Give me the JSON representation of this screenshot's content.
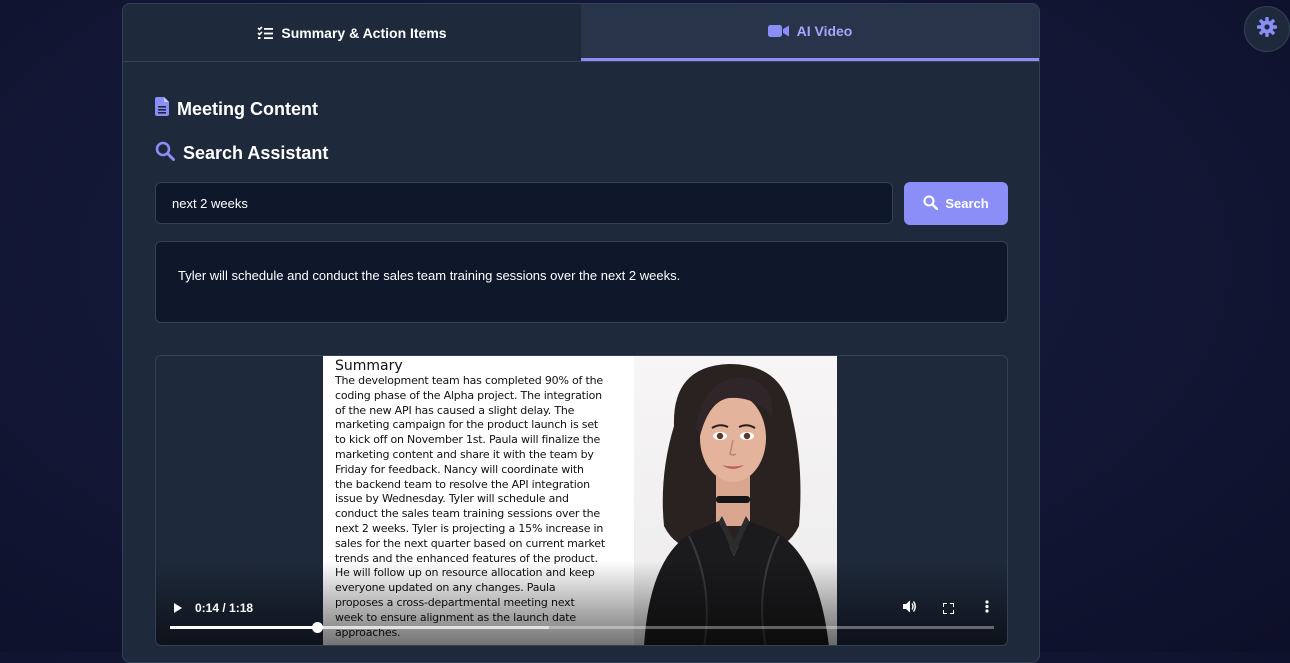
{
  "tabs": {
    "summary_label": "Summary & Action Items",
    "video_label": "AI Video"
  },
  "content": {
    "meeting_heading": "Meeting Content",
    "search_heading": "Search Assistant"
  },
  "search": {
    "value": "next 2 weeks",
    "button_label": "Search",
    "result": "Tyler will schedule and conduct the sales team training sessions over the next 2 weeks."
  },
  "video": {
    "frame_title": "Summary",
    "frame_lines": [
      "The development team has completed 90% of the",
      "coding phase of the Alpha project. The integration",
      "of the new API has caused a slight delay. The",
      "marketing campaign for the product launch is set",
      "to kick off on November 1st. Paula will finalize the",
      "marketing content and share it with the team by",
      "Friday for feedback. Nancy will coordinate with",
      "the backend team to resolve the API integration",
      "issue by Wednesday. Tyler will schedule and",
      "conduct the sales team training sessions over the",
      "next 2 weeks. Tyler is projecting a 15% increase in",
      "sales for the next quarter based on current market",
      "trends and the enhanced features of the product.",
      "He will follow up on resource allocation and keep",
      "everyone updated on any changes. Paula",
      "proposes a cross-departmental meeting next",
      "week to ensure alignment as the launch date",
      "approaches."
    ],
    "time_display": "0:14 / 1:18",
    "progress_fraction": 0.179,
    "buffered_fraction": 0.46
  },
  "icons": {
    "summary_tab": "list-check-icon",
    "video_tab": "video-camera-icon",
    "meeting": "document-icon",
    "search": "magnifier-icon",
    "play": "play-icon",
    "volume": "volume-icon",
    "fullscreen": "fullscreen-icon",
    "more": "more-vertical-icon",
    "settings": "gear-icon"
  },
  "colors": {
    "accent": "#8b8ef7",
    "card": "#1e293b",
    "field": "#0f172a",
    "border": "#334155"
  }
}
